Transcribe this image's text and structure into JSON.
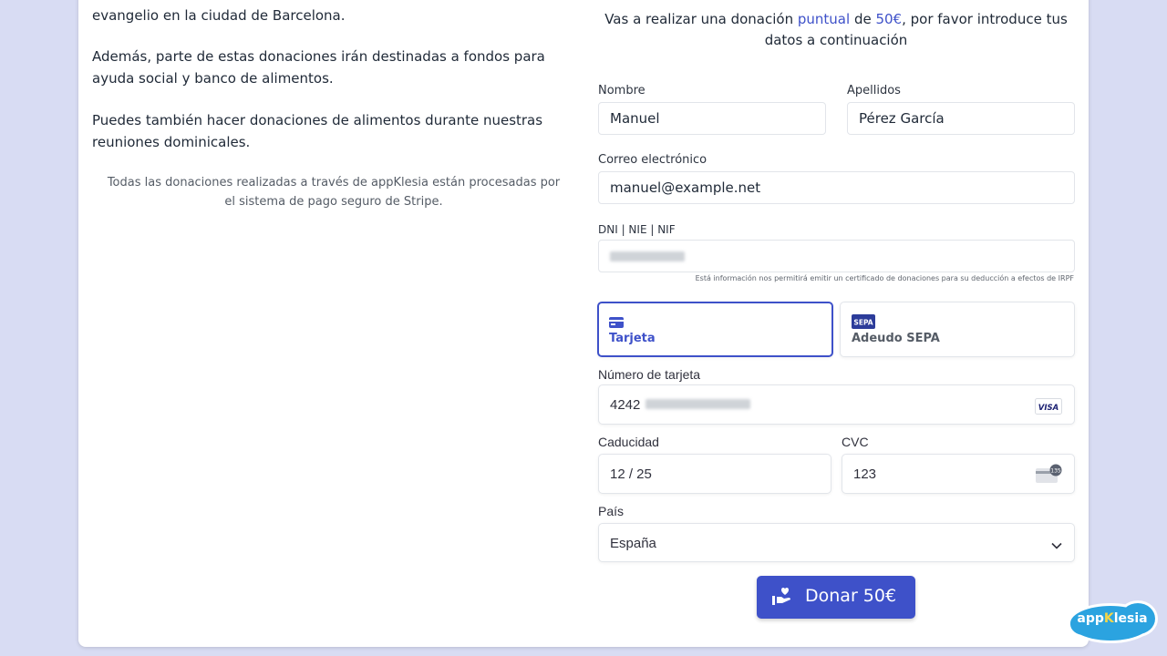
{
  "left_column": {
    "paragraph_1": "evangelio en la ciudad de Barcelona.",
    "paragraph_2": "Además, parte de estas donaciones irán destinadas a fondos para ayuda social y banco de alimentos.",
    "paragraph_3": "Puedes también hacer donaciones de alimentos durante nuestras reuniones dominicales.",
    "stripe_note": "Todas las donaciones realizadas a través de appKlesia están procesadas por el sistema de pago seguro de Stripe."
  },
  "intro": {
    "prefix": "Vas a realizar una donación ",
    "frequency": "puntual",
    "middle": " de ",
    "amount": "50€",
    "suffix": ", por favor introduce tus datos a continuación"
  },
  "form": {
    "first_name": {
      "label": "Nombre",
      "value": "Manuel"
    },
    "last_name": {
      "label": "Apellidos",
      "value": "Pérez García"
    },
    "email": {
      "label": "Correo electrónico",
      "value": "manuel@example.net"
    },
    "dni": {
      "label": "DNI | NIE | NIF",
      "hint": "Está información nos permitirá emitir un certificado de donaciones para su deducción a efectos de IRPF"
    }
  },
  "payment_methods": {
    "card": {
      "label": "Tarjeta",
      "active": true
    },
    "sepa": {
      "label": "Adeudo SEPA",
      "badge": "SEPA"
    }
  },
  "card_form": {
    "number_label": "Número de tarjeta",
    "number_prefix": "4242",
    "brand": "VISA",
    "expiry_label": "Caducidad",
    "expiry_value": "12 / 25",
    "cvc_label": "CVC",
    "cvc_value": "123",
    "cvc_badge": "135",
    "country_label": "País",
    "country_value": "España"
  },
  "donate_button": {
    "label": "Donar 50€"
  },
  "logo": {
    "prefix": "app",
    "highlight": "K",
    "suffix": "lesia"
  },
  "colors": {
    "accent": "#3e51c9",
    "background": "#d8dcf3",
    "logo_blue": "#2ba3e0"
  },
  "icons": [
    "credit-card-icon",
    "sepa-icon",
    "visa-icon",
    "cvc-card-icon",
    "chevron-down-icon",
    "donate-hand-icon",
    "cloud-logo"
  ]
}
